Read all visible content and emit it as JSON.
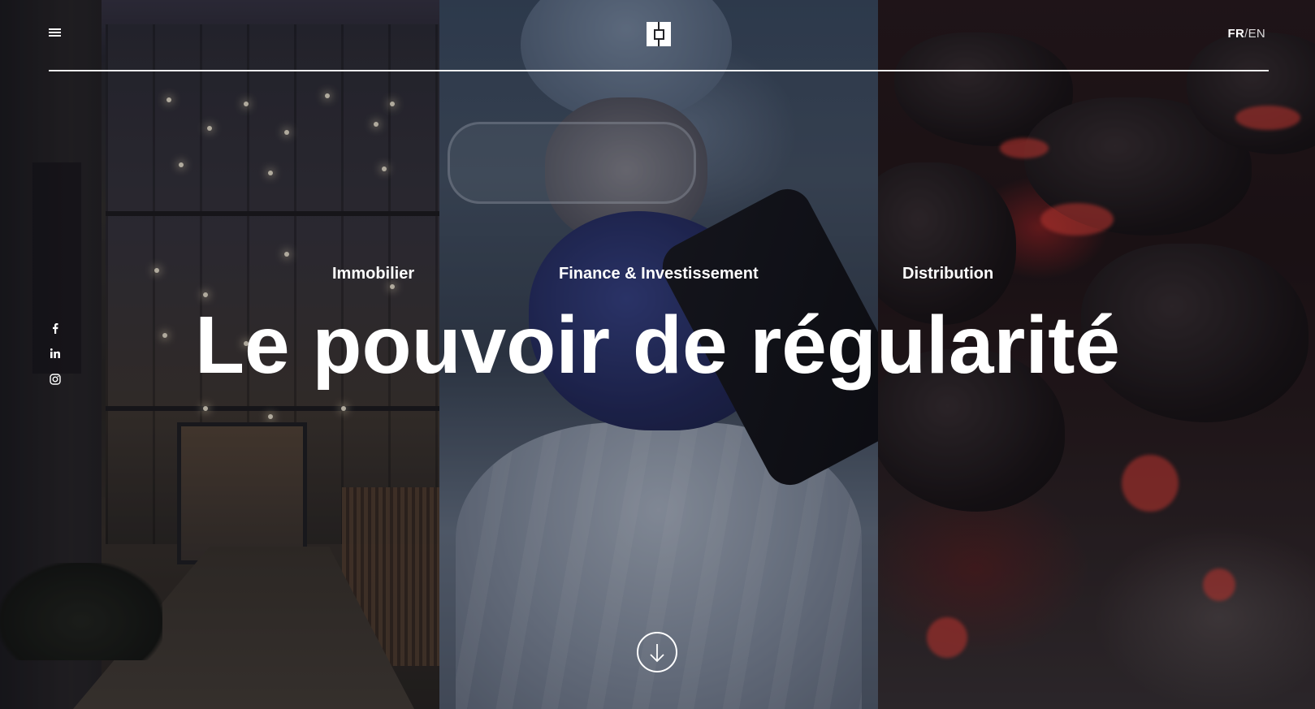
{
  "header": {
    "menu_icon": "hamburger-menu-icon",
    "logo_icon": "square-logo-icon",
    "lang_fr": "FR",
    "lang_sep": "/",
    "lang_en": "EN"
  },
  "social": {
    "items": [
      {
        "icon": "facebook-icon"
      },
      {
        "icon": "linkedin-icon"
      },
      {
        "icon": "instagram-icon"
      }
    ]
  },
  "categories": [
    {
      "label": "Immobilier"
    },
    {
      "label": "Finance & Investissement"
    },
    {
      "label": "Distribution"
    }
  ],
  "hero": {
    "headline": "Le pouvoir de régularité",
    "scroll_icon": "arrow-down-icon"
  },
  "colors": {
    "text": "#ffffff",
    "overlay": "#0a0a0f"
  }
}
